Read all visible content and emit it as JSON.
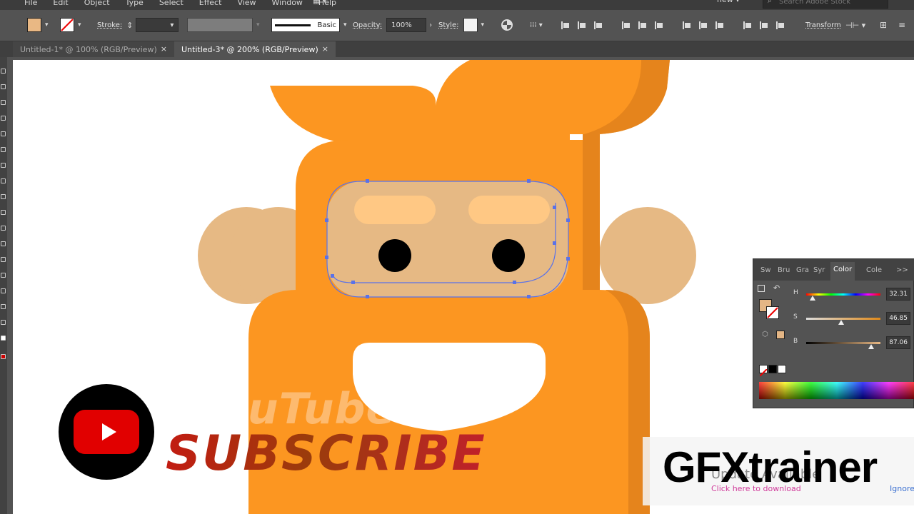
{
  "menubar": {
    "items": [
      "File",
      "Edit",
      "Object",
      "Type",
      "Select",
      "Effect",
      "View",
      "Window",
      "Help"
    ],
    "workspace": "new",
    "stock_placeholder": "Search Adobe Stock"
  },
  "control": {
    "fill_color": "#E9B884",
    "stroke_label": "Stroke:",
    "stroke_profile": "Basic",
    "opacity_label": "Opacity:",
    "opacity_value": "100%",
    "style_label": "Style:",
    "transform_label": "Transform"
  },
  "tabs": [
    {
      "label": "Untitled-1* @ 100% (RGB/Preview)",
      "close": "×"
    },
    {
      "label": "Untitled-3* @ 200% (RGB/Preview)",
      "close": "×"
    }
  ],
  "color_panel": {
    "tabs": [
      "Sw",
      "Bru",
      "Gra",
      "Syr",
      "Color",
      "Cole",
      ">>"
    ],
    "channels": [
      {
        "name": "H",
        "value": "32.31",
        "fraction": 0.0897
      },
      {
        "name": "S",
        "value": "46.85",
        "fraction": 0.4685
      },
      {
        "name": "B",
        "value": "87.06",
        "fraction": 0.8706
      }
    ],
    "fill_color": "#E4B685"
  },
  "artwork": {
    "orange": "#FC9621",
    "orange_dark": "#E5841C",
    "skin": "#E6B984",
    "skin_light": "#FFC884",
    "selection": "#5A72E8"
  },
  "overlay": {
    "yt_text": "YouTube",
    "subscribe": "SUBSCRIBE",
    "update_title": "Update Available",
    "update_link": "Click here to download",
    "update_ignore": "Ignore",
    "brand": "GFXtrainer"
  }
}
